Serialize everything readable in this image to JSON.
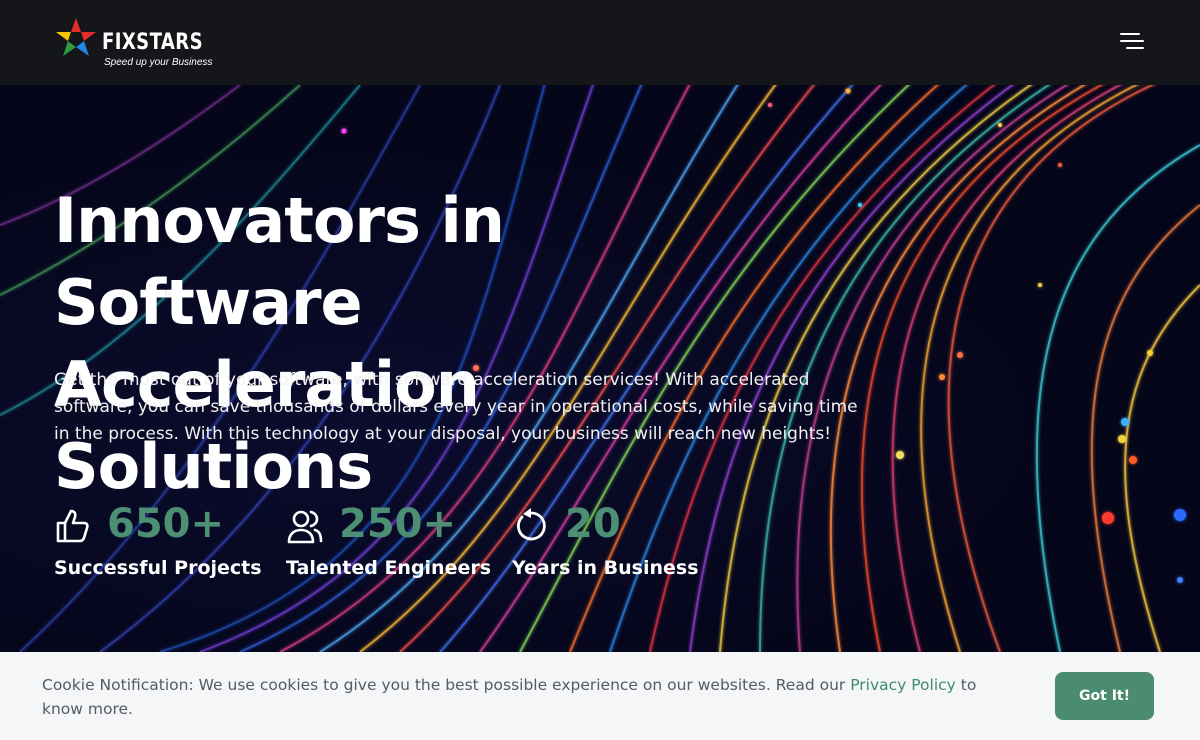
{
  "header": {
    "brand": "FIXSTARS",
    "tagline": "Speed up your Business",
    "menu_icon": "hamburger-menu-icon"
  },
  "hero": {
    "headline_line1": "Innovators in Software",
    "headline_line2": "Acceleration Solutions",
    "description": "Get the most out of your software, with software acceleration services! With accelerated software, you can save thousands of dollars every year in operational costs, while saving time in the process. With this technology at your disposal, your business will reach new heights!"
  },
  "stats": [
    {
      "icon": "thumbs-up-icon",
      "value": "650+",
      "label": "Successful Projects"
    },
    {
      "icon": "users-icon",
      "value": "250+",
      "label": "Talented Engineers"
    },
    {
      "icon": "rotate-icon",
      "value": "20",
      "label": "Years in Business"
    }
  ],
  "cookie": {
    "text_before": "Cookie Notification: We use cookies to give you the best possible experience on our websites. Read our ",
    "link_text": "Privacy Policy",
    "text_after": " to know more.",
    "button_label": "Got It!"
  },
  "colors": {
    "accent": "#4d8f72",
    "header_bg": "#14161a",
    "cookie_bg": "#f4f6f8",
    "button_bg": "#4a8b72"
  }
}
